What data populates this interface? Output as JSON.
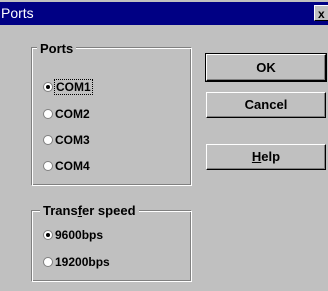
{
  "window": {
    "title": "Ports",
    "close_glyph": "x"
  },
  "ports_group": {
    "legend": "Ports",
    "options": [
      {
        "label": "COM1",
        "selected": true
      },
      {
        "label": "COM2",
        "selected": false
      },
      {
        "label": "COM3",
        "selected": false
      },
      {
        "label": "COM4",
        "selected": false
      }
    ]
  },
  "speed_group": {
    "legend_before": "Trans",
    "legend_underlined": "f",
    "legend_after": "er speed",
    "options": [
      {
        "label": "9600bps",
        "selected": true
      },
      {
        "label": "19200bps",
        "selected": false
      }
    ]
  },
  "buttons": {
    "ok": "OK",
    "cancel": "Cancel",
    "help_underlined": "H",
    "help_rest": "elp"
  }
}
